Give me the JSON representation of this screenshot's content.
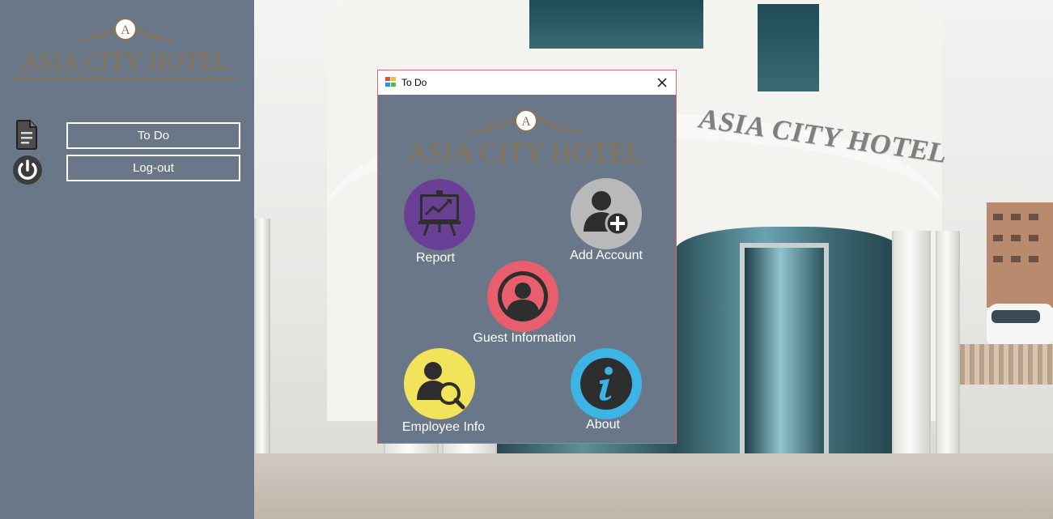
{
  "brand": {
    "logo_letter": "A",
    "name": "ASIA CITY HOTEL",
    "subtitle": "ISTANBUL"
  },
  "sidebar": {
    "icons": [
      "document-icon",
      "power-icon"
    ],
    "buttons": [
      {
        "label": "To Do"
      },
      {
        "label": "Log-out"
      }
    ]
  },
  "background": {
    "sign_text": "ASIA CITY HOTEL"
  },
  "dialog": {
    "title": "To Do",
    "close_icon": "close-icon",
    "items": [
      {
        "label": "Report",
        "icon": "presentation-chart-icon",
        "color": "#6a3f96"
      },
      {
        "label": "Add Account",
        "icon": "add-user-icon",
        "color": "#b9b9b9"
      },
      {
        "label": "Guest Information",
        "icon": "user-circle-icon",
        "color": "#e85e6d"
      },
      {
        "label": "Employee Info",
        "icon": "search-user-icon",
        "color": "#f2e45a"
      },
      {
        "label": "About",
        "icon": "info-icon",
        "color": "#3cb4e6"
      }
    ]
  },
  "colors": {
    "panel": "#6a7789",
    "accent_border": "#d46a7e",
    "gold": "#8a7450"
  }
}
